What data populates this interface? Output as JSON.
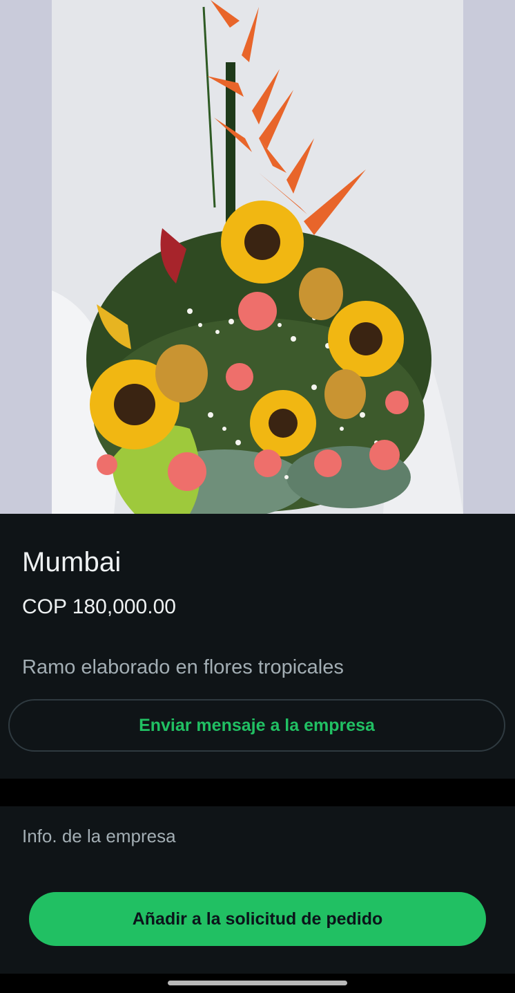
{
  "product": {
    "image_alt": "Arreglo floral tropical con girasoles, rosas y heliconias",
    "name": "Mumbai",
    "price": "COP 180,000.00",
    "description": "Ramo elaborado en flores tropicales"
  },
  "actions": {
    "message_label": "Enviar mensaje a la empresa",
    "add_to_order_label": "Añadir a la solicitud de pedido"
  },
  "business": {
    "info_label": "Info. de la empresa"
  },
  "colors": {
    "accent": "#21c063",
    "background": "#0f1417",
    "secondary_text": "#a3aeb4"
  }
}
